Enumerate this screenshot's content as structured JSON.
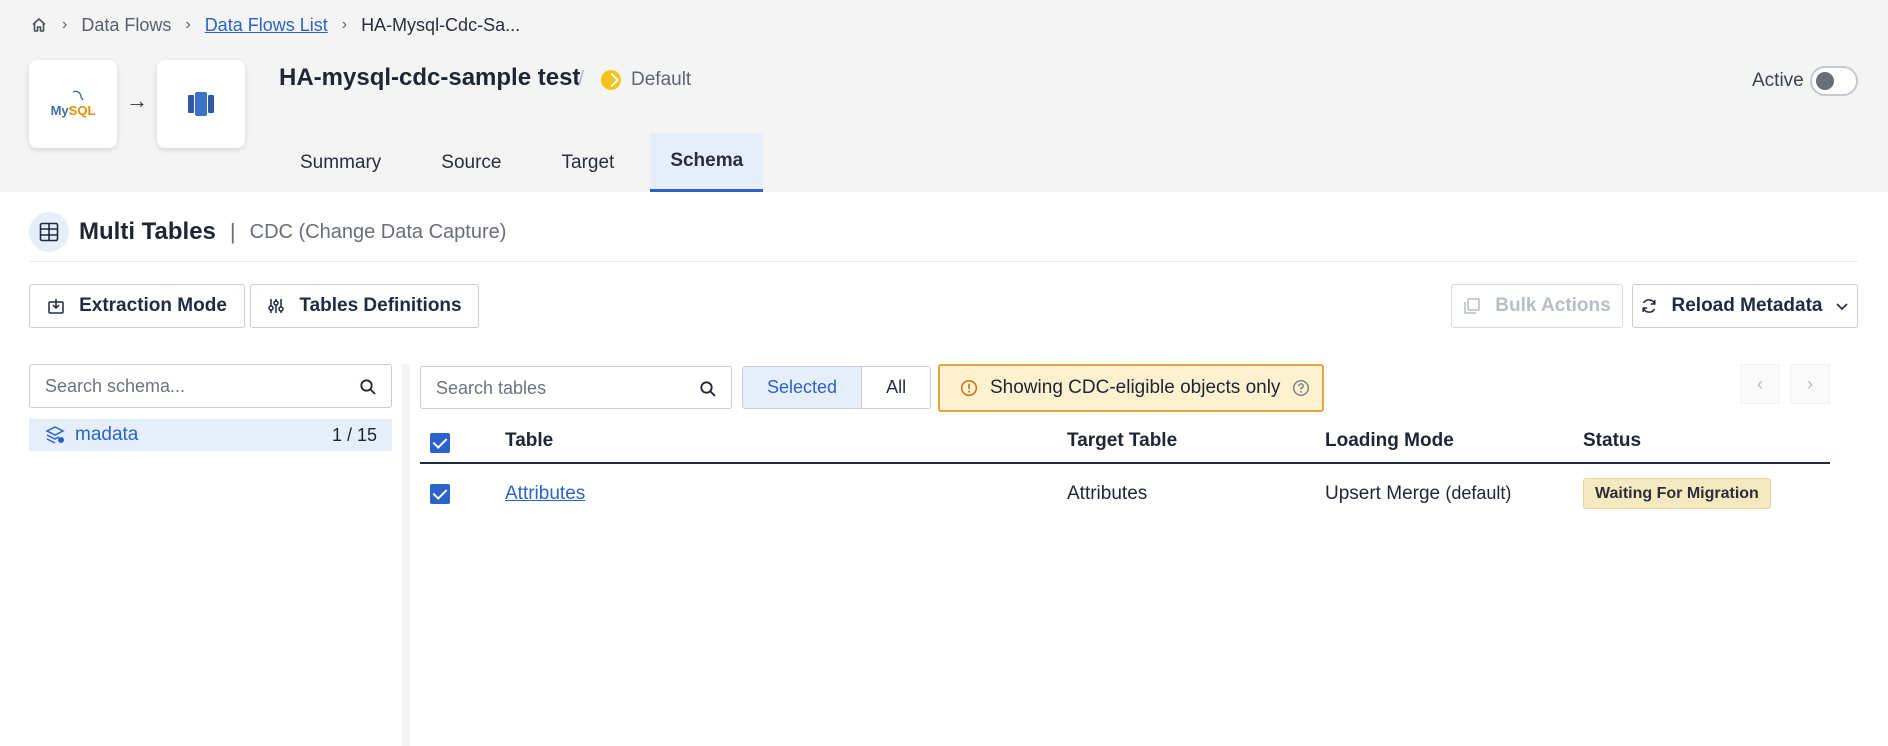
{
  "breadcrumb": {
    "home_icon": "home-icon",
    "items": [
      "Data Flows",
      "Data Flows List",
      "HA-Mysql-Cdc-Sa..."
    ]
  },
  "flow": {
    "source_logo": "MySQL",
    "target_logo_icon": "redshift-icon",
    "title": "HA-mysql-cdc-sample test",
    "environment": "Default",
    "active_label": "Active",
    "active": false
  },
  "tabs": [
    "Summary",
    "Source",
    "Target",
    "Schema"
  ],
  "active_tab": "Schema",
  "section": {
    "title": "Multi Tables",
    "subtitle": "CDC (Change Data Capture)"
  },
  "toolbar": {
    "extraction_mode": "Extraction Mode",
    "tables_definitions": "Tables Definitions",
    "bulk_actions": "Bulk Actions",
    "reload_metadata": "Reload Metadata"
  },
  "schema_panel": {
    "search_placeholder": "Search schema...",
    "schemas": [
      {
        "name": "madata",
        "count": "1 / 15"
      }
    ]
  },
  "tables_panel": {
    "search_placeholder": "Search tables",
    "filter_options": [
      "Selected",
      "All"
    ],
    "notice": "Showing CDC-eligible objects only",
    "columns": [
      "Table",
      "Target Table",
      "Loading Mode",
      "Status"
    ],
    "rows": [
      {
        "table": "Attributes",
        "target_table": "Attributes",
        "loading_mode": "Upsert Merge",
        "loading_mode_suffix": "(default)",
        "status": "Waiting For Migration"
      }
    ]
  },
  "colors": {
    "accent": "#2b63c9",
    "notice_bg": "#fdf1cf",
    "notice_border": "#e8a33d",
    "status_bg": "#f6e9bf"
  }
}
